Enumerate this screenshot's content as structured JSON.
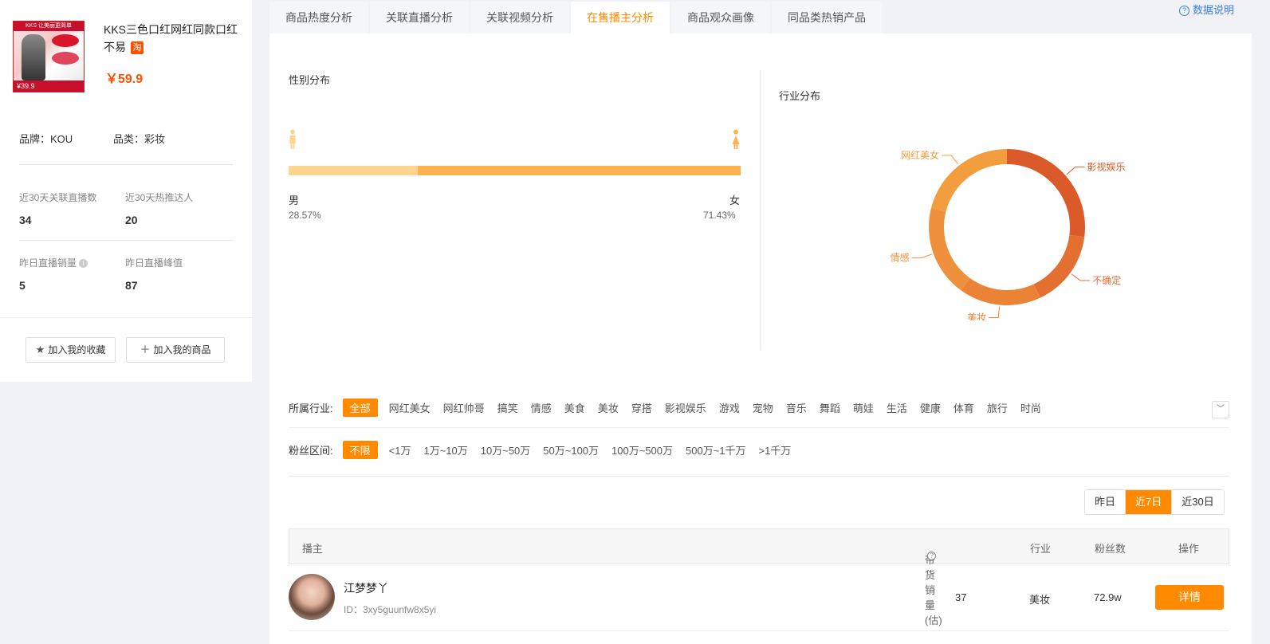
{
  "product": {
    "image_banner": "KKS 让美丽更简单",
    "image_price": "¥39.9",
    "title": "KKS三色口红网红同款口红不易",
    "platform_badge": "淘",
    "price": "￥59.9",
    "brand_label": "品牌：KOU",
    "category_label": "品类：彩妆"
  },
  "stats": [
    {
      "label": "近30天关联直播数",
      "value": "34"
    },
    {
      "label": "近30天热推达人",
      "value": "20"
    },
    {
      "label": "昨日直播销量",
      "value": "5"
    },
    {
      "label": "昨日直播峰值",
      "value": "87"
    }
  ],
  "actions": {
    "fav_label": "加入我的收藏",
    "add_label": "加入我的商品"
  },
  "tabs": [
    {
      "label": "商品热度分析",
      "active": false
    },
    {
      "label": "关联直播分析",
      "active": false
    },
    {
      "label": "关联视频分析",
      "active": false
    },
    {
      "label": "在售播主分析",
      "active": true
    },
    {
      "label": "商品观众画像",
      "active": false
    },
    {
      "label": "同品类热销产品",
      "active": false
    }
  ],
  "help_label": "数据说明",
  "gender": {
    "title": "性别分布",
    "male_label": "男",
    "female_label": "女",
    "male_pct_text": "28.57%",
    "female_pct_text": "71.43%",
    "male_fraction": 0.2857,
    "colors": {
      "male": "#fed48e",
      "female": "#fdb14f"
    }
  },
  "industry": {
    "title": "行业分布",
    "slices": [
      {
        "label": "影视娱乐",
        "value": 27,
        "color": "#db5a2a"
      },
      {
        "label": "不确定",
        "value": 16,
        "color": "#e36f30"
      },
      {
        "label": "美妆",
        "value": 17,
        "color": "#eb8336"
      },
      {
        "label": "情感",
        "value": 19,
        "color": "#ef913c"
      },
      {
        "label": "网红美女",
        "value": 21,
        "color": "#f29e3e"
      }
    ]
  },
  "filters": {
    "industry_label": "所属行业:",
    "industry_options": [
      "全部",
      "网红美女",
      "网红帅哥",
      "搞笑",
      "情感",
      "美食",
      "美妆",
      "穿搭",
      "影视娱乐",
      "游戏",
      "宠物",
      "音乐",
      "舞蹈",
      "萌娃",
      "生活",
      "健康",
      "体育",
      "旅行",
      "时尚"
    ],
    "fans_label": "粉丝区间:",
    "fans_options": [
      "不限",
      "<1万",
      "1万~10万",
      "10万~50万",
      "50万~100万",
      "100万~500万",
      "500万~1千万",
      ">1千万"
    ]
  },
  "period": {
    "options": [
      "昨日",
      "近7日",
      "近30日"
    ],
    "active_index": 1
  },
  "table": {
    "headers": {
      "host": "播主",
      "sales": "带货销量(估)",
      "industry": "行业",
      "fans": "粉丝数",
      "action": "操作"
    },
    "rows": [
      {
        "name": "江梦梦丫",
        "id": "ID：3xy5guunfw8x5yi",
        "sales": "37",
        "industry": "美妆",
        "fans": "72.9w",
        "action": "详情"
      }
    ]
  }
}
